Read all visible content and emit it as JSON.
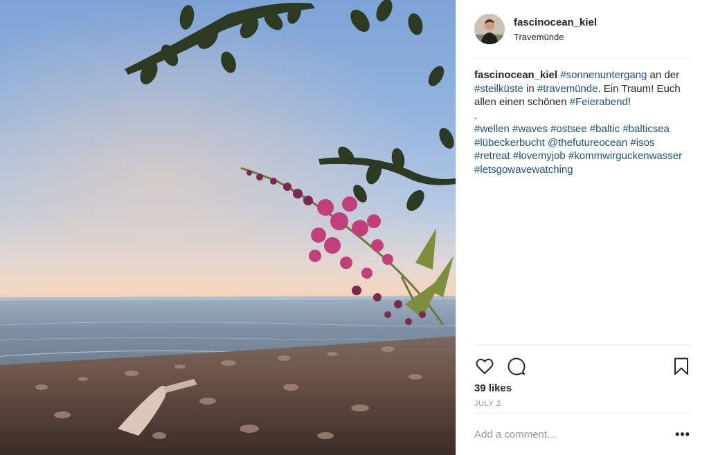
{
  "post": {
    "image_alt": "Sunset over the Baltic Sea with pink flowers on the shore",
    "author": {
      "username": "fascinocean_kiel",
      "location": "Travemünde"
    },
    "caption": {
      "username": "fascinocean_kiel",
      "segments": [
        {
          "t": " "
        },
        {
          "t": "#sonnenuntergang",
          "tag": true
        },
        {
          "t": " an der "
        },
        {
          "t": "#steilküste",
          "tag": true
        },
        {
          "t": " in "
        },
        {
          "t": "#travemünde",
          "tag": true
        },
        {
          "t": ". Ein Traum! Euch allen einen schönen "
        },
        {
          "t": "#Feierabend",
          "tag": true
        },
        {
          "t": "!"
        },
        {
          "br": true
        },
        {
          "t": "."
        },
        {
          "br": true
        },
        {
          "t": "#wellen",
          "tag": true
        },
        {
          "t": " "
        },
        {
          "t": "#waves",
          "tag": true
        },
        {
          "t": " "
        },
        {
          "t": "#ostsee",
          "tag": true
        },
        {
          "t": " "
        },
        {
          "t": "#baltic",
          "tag": true
        },
        {
          "t": " "
        },
        {
          "t": "#balticsea",
          "tag": true
        },
        {
          "t": " "
        },
        {
          "t": "#lübeckerbucht",
          "tag": true
        },
        {
          "t": " "
        },
        {
          "t": "@thefutureocean",
          "tag": true
        },
        {
          "t": " "
        },
        {
          "t": "#isos",
          "tag": true
        },
        {
          "t": " "
        },
        {
          "t": "#retreat",
          "tag": true
        },
        {
          "t": " "
        },
        {
          "t": "#lovemyjob",
          "tag": true
        },
        {
          "t": " "
        },
        {
          "t": "#kommwirguckenwasser",
          "tag": true
        },
        {
          "t": " "
        },
        {
          "t": "#letsgowavewatching",
          "tag": true
        }
      ]
    },
    "actions": {
      "like_icon": "heart-icon",
      "comment_icon": "comment-bubble-icon",
      "save_icon": "bookmark-icon"
    },
    "likes": "39 likes",
    "date": "JULY 2",
    "comment_placeholder": "Add a comment…",
    "more_label": "•••"
  },
  "colors": {
    "link": "#1d4f8a",
    "text": "#262626",
    "muted": "#999999",
    "divider": "#efefef"
  }
}
